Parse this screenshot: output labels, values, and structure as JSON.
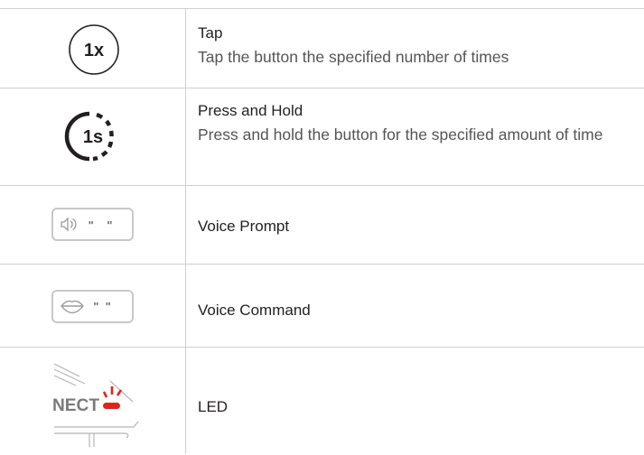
{
  "rows": [
    {
      "icon": "tap-1x-icon",
      "icon_label": "1x",
      "term": "Tap",
      "desc": "Tap the button the specified number of times"
    },
    {
      "icon": "press-hold-1s-icon",
      "icon_label": "1s",
      "term": "Press and Hold",
      "desc": "Press and hold the button for the specified amount of time"
    },
    {
      "icon": "voice-prompt-icon",
      "icon_label": "\"    \"",
      "term": "Voice Prompt"
    },
    {
      "icon": "voice-command-icon",
      "icon_label": "\"  \"",
      "term": "Voice Command"
    },
    {
      "icon": "led-icon",
      "icon_label": "NECT",
      "term": "LED"
    }
  ],
  "colors": {
    "text": "#231f20",
    "desc": "#555555",
    "rule": "#cfcfcf",
    "led": "#e2231a",
    "icon_border": "#c8c8c8"
  }
}
